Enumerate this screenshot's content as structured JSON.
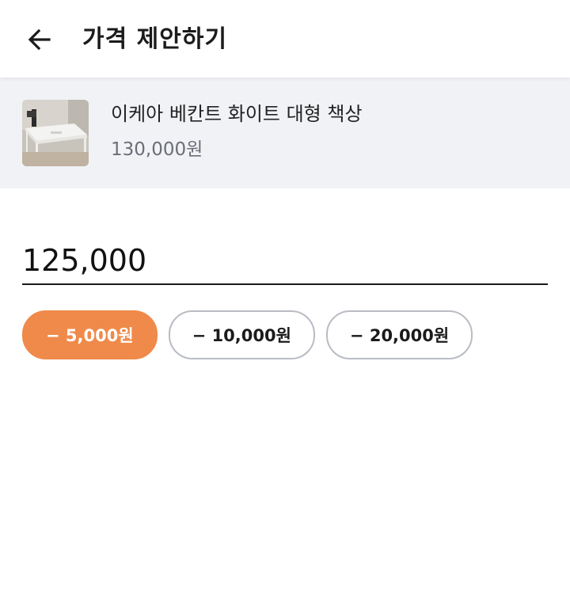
{
  "header": {
    "title": "가격 제안하기",
    "back_icon": "arrow-left-icon"
  },
  "product": {
    "name": "이케아 베칸트 화이트 대형 책상",
    "price": "130,000원"
  },
  "offer": {
    "value": "125,000"
  },
  "chips": [
    {
      "label": "− 5,000원",
      "active": true
    },
    {
      "label": "− 10,000원",
      "active": false
    },
    {
      "label": "− 20,000원",
      "active": false
    }
  ],
  "colors": {
    "accent": "#ef8a4a",
    "panel_bg": "#f1f2f6",
    "muted_text": "#6b6e76",
    "chip_border": "#b9bcc4"
  }
}
